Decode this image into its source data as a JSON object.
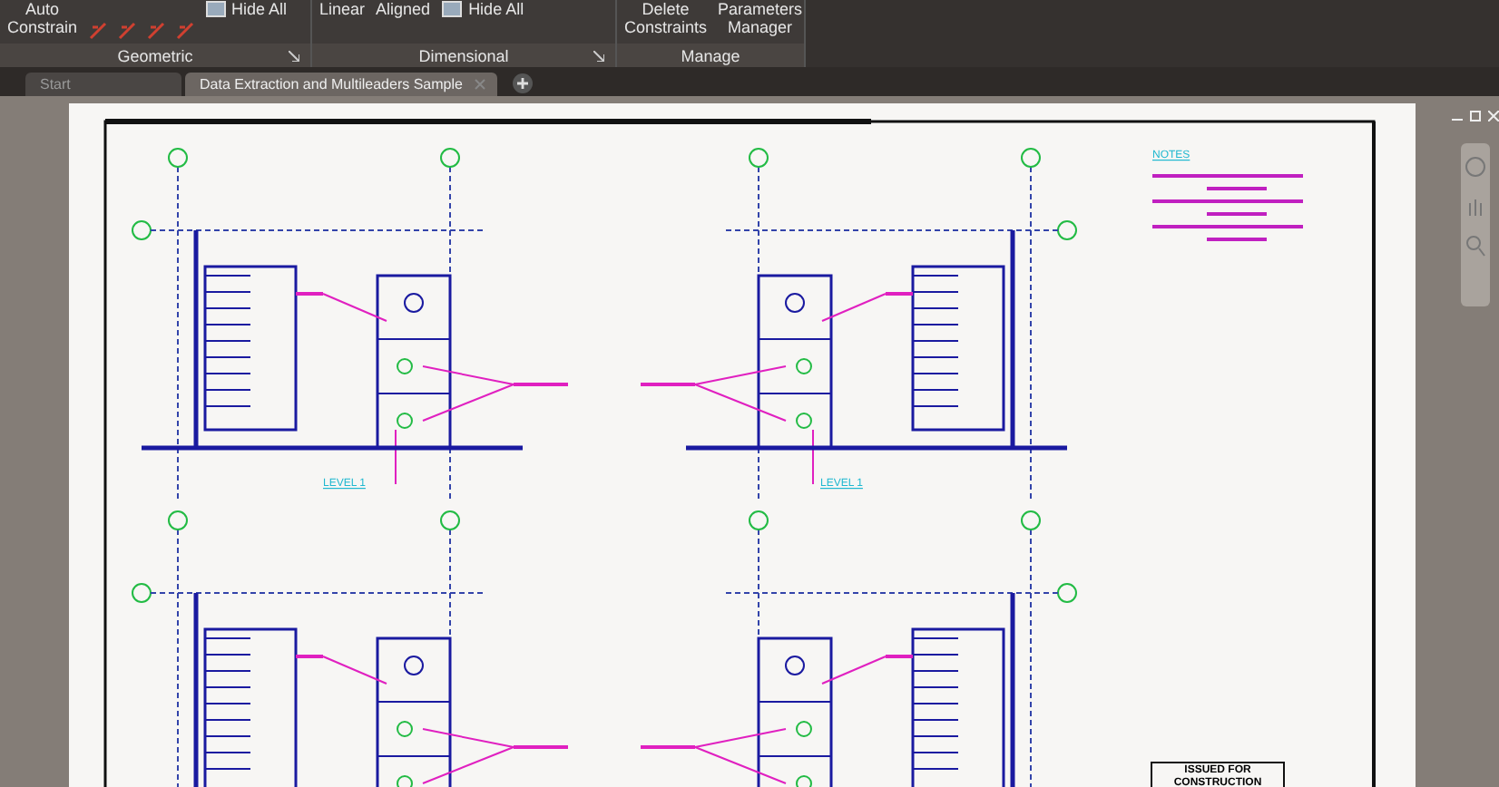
{
  "ribbon": {
    "panels": [
      {
        "title": "Geometric",
        "has_launcher": true,
        "buttons": [
          {
            "label": "Auto\nConstrain"
          },
          {
            "label": "Hide All"
          }
        ]
      },
      {
        "title": "Dimensional",
        "has_launcher": true,
        "buttons": [
          {
            "label": "Linear"
          },
          {
            "label": "Aligned"
          },
          {
            "label": "Hide All"
          }
        ]
      },
      {
        "title": "Manage",
        "has_launcher": false,
        "buttons": [
          {
            "label": "Delete\nConstraints"
          },
          {
            "label": "Parameters\nManager"
          }
        ]
      }
    ]
  },
  "tabs": [
    {
      "label": "Start",
      "selected": false
    },
    {
      "label": "Data Extraction and Multileaders Sample",
      "selected": true
    }
  ],
  "drawing": {
    "notes_heading": "NOTES",
    "plan_labels": [
      "LEVEL 1",
      "LEVEL 1"
    ],
    "stamp": "ISSUED FOR\nCONSTRUCTION"
  }
}
